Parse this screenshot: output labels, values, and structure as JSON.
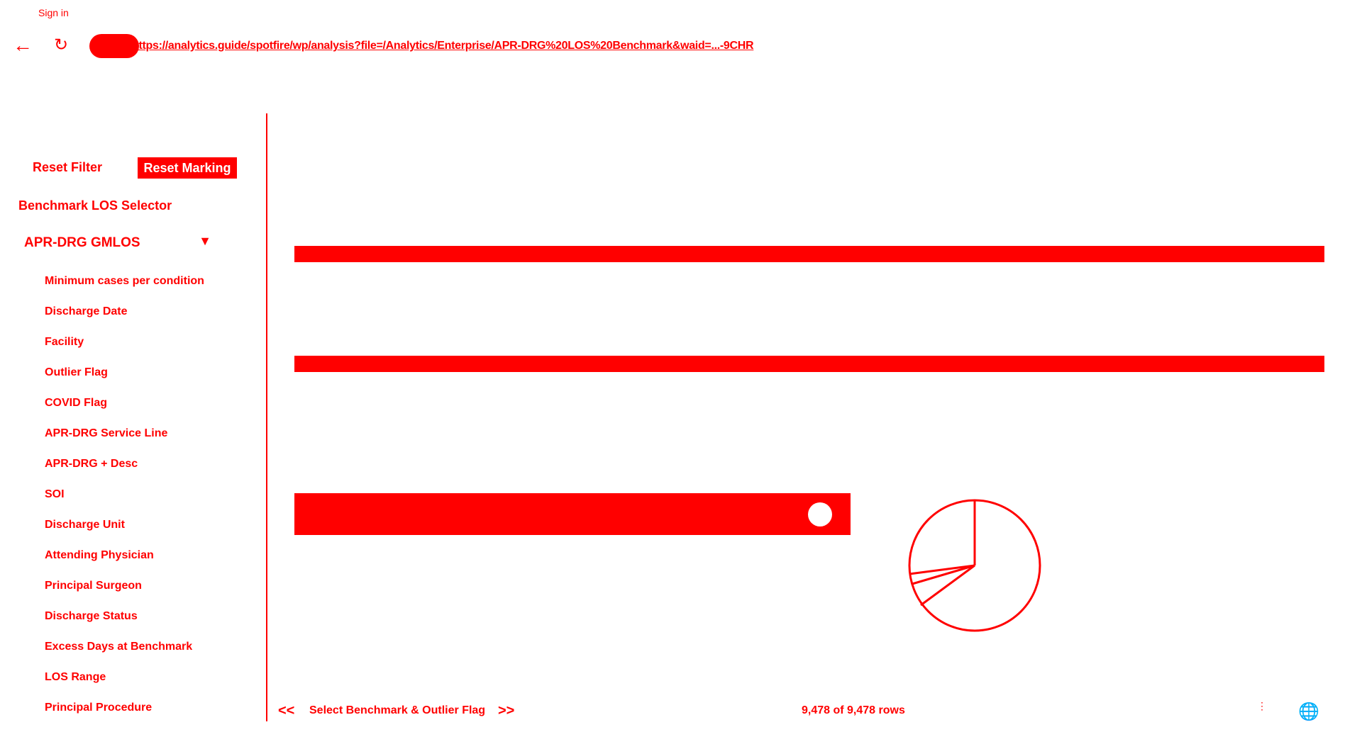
{
  "header": {
    "signin": "Sign in",
    "url": "https://analytics.guide/spotfire/wp/analysis?file=/Analytics/Enterprise/APR-DRG%20LOS%20Benchmark&waid=...-9CHR",
    "icons": {
      "back": "back-arrow-icon",
      "reload": "reload-icon",
      "lock": "lock-icon"
    }
  },
  "sidebar": {
    "reset_filter": "Reset Filter",
    "reset_marking": "Reset Marking",
    "benchmark_label": "Benchmark LOS Selector",
    "benchmark_value": "APR-DRG GMLOS",
    "filters": [
      "Minimum cases per condition",
      "Discharge Date",
      "Facility",
      "Outlier Flag",
      "COVID Flag",
      "APR-DRG Service Line",
      "APR-DRG + Desc",
      "SOI",
      "Discharge Unit",
      "Attending Physician",
      "Principal Surgeon",
      "Discharge Status",
      "Excess Days at Benchmark",
      "LOS Range",
      "Principal Procedure"
    ]
  },
  "footer": {
    "prev": "<<",
    "next": ">>",
    "tab_label": "Select Benchmark & Outlier Flag",
    "rows": "9,478 of 9,478 rows"
  },
  "colors": {
    "accent": "#ff0000",
    "background": "#ffffff"
  }
}
